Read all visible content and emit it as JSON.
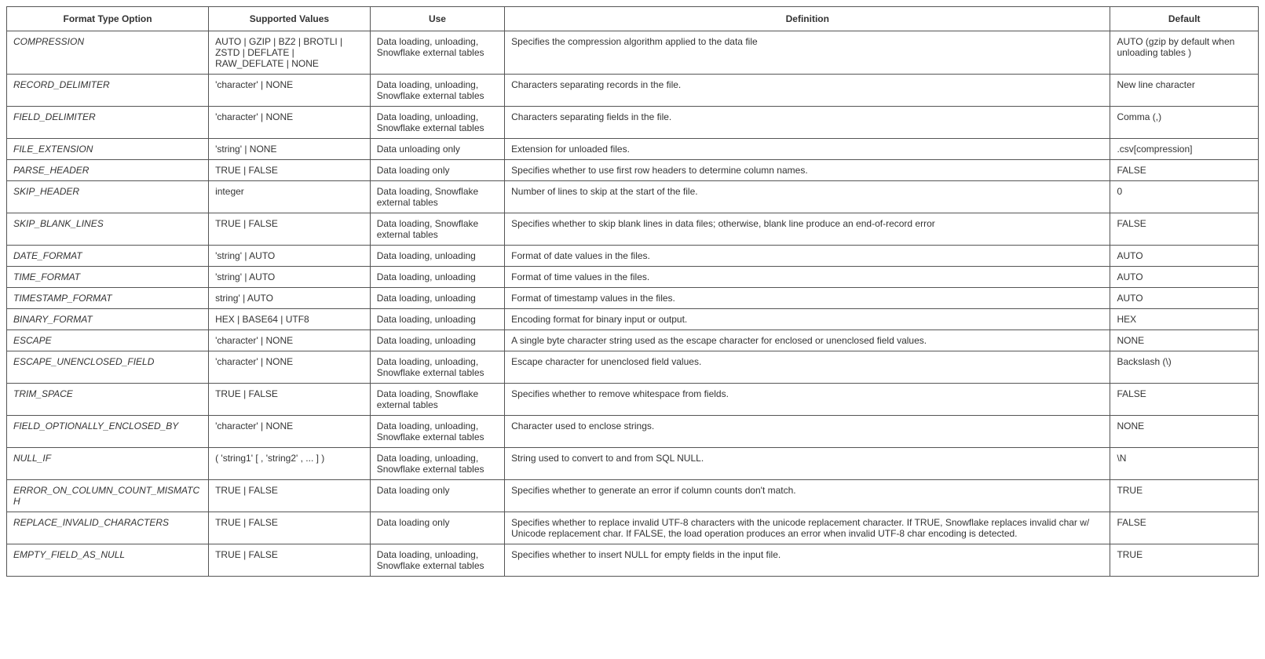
{
  "headers": {
    "option": "Format Type Option",
    "supported": "Supported Values",
    "use": "Use",
    "definition": "Definition",
    "default": "Default"
  },
  "rows": [
    {
      "option": "COMPRESSION",
      "supported": "AUTO | GZIP | BZ2 | BROTLI | ZSTD | DEFLATE | RAW_DEFLATE | NONE",
      "use": "Data loading, unloading, Snowflake external tables",
      "definition": "Specifies the compression algorithm applied to the data file",
      "default": "AUTO (gzip by default when unloading tables )"
    },
    {
      "option": "RECORD_DELIMITER",
      "supported": "'character' | NONE",
      "use": "Data loading, unloading, Snowflake external tables",
      "definition": "Characters separating records in the file.",
      "default": "New line character"
    },
    {
      "option": "FIELD_DELIMITER",
      "supported": "'character' | NONE",
      "use": "Data loading, unloading, Snowflake external tables",
      "definition": "Characters separating fields in the file.",
      "default": "Comma (,)"
    },
    {
      "option": "FILE_EXTENSION",
      "supported": "'string' | NONE",
      "use": "Data unloading only",
      "definition": "Extension for unloaded files.",
      "default": ".csv[compression]"
    },
    {
      "option": "PARSE_HEADER",
      "supported": "TRUE | FALSE",
      "use": "Data loading only",
      "definition": "Specifies whether to use first row headers to determine column names.",
      "default": "FALSE"
    },
    {
      "option": "SKIP_HEADER",
      "supported": "integer",
      "use": "Data loading, Snowflake external tables",
      "definition": "Number of lines to skip at the start of the file.",
      "default": "0"
    },
    {
      "option": "SKIP_BLANK_LINES",
      "supported": "TRUE | FALSE",
      "use": "Data loading, Snowflake external tables",
      "definition": "Specifies whether to skip blank lines in data files; otherwise, blank line produce an end-of-record error",
      "default": "FALSE"
    },
    {
      "option": "DATE_FORMAT",
      "supported": "'string' | AUTO",
      "use": "Data loading, unloading",
      "definition": "Format of date values in the files.",
      "default": "AUTO"
    },
    {
      "option": "TIME_FORMAT",
      "supported": "'string' | AUTO",
      "use": "Data loading, unloading",
      "definition": "Format of time values in the files.",
      "default": "AUTO"
    },
    {
      "option": "TIMESTAMP_FORMAT",
      "supported": "string' | AUTO",
      "use": "Data loading, unloading",
      "definition": "Format of timestamp values in the files.",
      "default": "AUTO"
    },
    {
      "option": "BINARY_FORMAT",
      "supported": "HEX | BASE64 | UTF8",
      "use": "Data loading, unloading",
      "definition": "Encoding format for binary input or output.",
      "default": "HEX"
    },
    {
      "option": "ESCAPE",
      "supported": "'character' | NONE",
      "use": "Data loading, unloading",
      "definition": "A single byte character string used as the escape character for enclosed or unenclosed field values.",
      "default": "NONE"
    },
    {
      "option": "ESCAPE_UNENCLOSED_FIELD",
      "supported": "'character' | NONE",
      "use": "Data loading, unloading, Snowflake external tables",
      "definition": "Escape character for unenclosed field values.",
      "default": "Backslash (\\)"
    },
    {
      "option": "TRIM_SPACE",
      "supported": "TRUE | FALSE",
      "use": "Data loading, Snowflake external tables",
      "definition": "Specifies whether to remove whitespace from fields.",
      "default": "FALSE"
    },
    {
      "option": "FIELD_OPTIONALLY_ENCLOSED_BY",
      "supported": "'character' | NONE",
      "use": "Data loading, unloading, Snowflake external tables",
      "definition": "Character used to enclose strings.",
      "default": "NONE"
    },
    {
      "option": "NULL_IF",
      "supported": "( 'string1' [ , 'string2' , ... ] )",
      "use": "Data loading, unloading, Snowflake external tables",
      "definition": "String used to convert to and from SQL NULL.",
      "default": "\\N"
    },
    {
      "option": "ERROR_ON_COLUMN_COUNT_MISMATCH",
      "supported": "TRUE | FALSE",
      "use": "Data loading only",
      "definition": "Specifies whether to generate an error if column counts don't match.",
      "default": "TRUE"
    },
    {
      "option": "REPLACE_INVALID_CHARACTERS",
      "supported": "TRUE | FALSE",
      "use": "Data loading only",
      "definition": "Specifies whether to replace invalid UTF-8 characters with the unicode replacement character. If TRUE, Snowflake replaces invalid char w/ Unicode replacement char. If FALSE, the load operation produces an error when invalid UTF-8 char encoding is detected.",
      "default": "FALSE"
    },
    {
      "option": "EMPTY_FIELD_AS_NULL",
      "supported": "TRUE | FALSE",
      "use": "Data loading, unloading, Snowflake external tables",
      "definition": "Specifies whether to insert NULL for empty fields in the input file.",
      "default": "TRUE"
    }
  ]
}
